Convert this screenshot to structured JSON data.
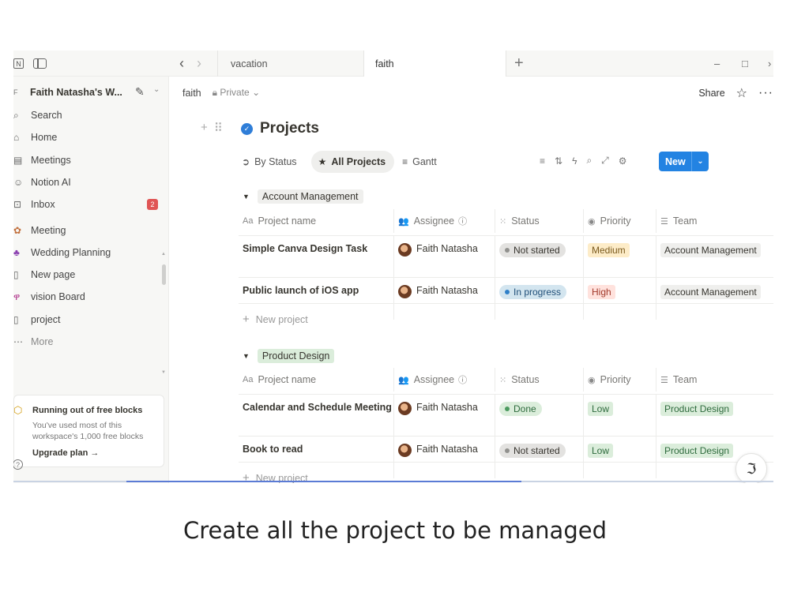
{
  "titlebar": {
    "tabs": [
      {
        "label": "vacation"
      },
      {
        "label": "faith"
      }
    ],
    "new_tab_symbol": "+",
    "window_controls": {
      "minimize": "–",
      "maximize": "□",
      "more": "›"
    }
  },
  "sidebar": {
    "workspace_badge": "F",
    "workspace_name": "Faith Natasha's W...",
    "top_items": [
      {
        "label": "Search",
        "icon": "search-icon"
      },
      {
        "label": "Home",
        "icon": "home-icon"
      },
      {
        "label": "Meetings",
        "icon": "meetings-icon"
      },
      {
        "label": "Notion AI",
        "icon": "notion-ai-icon"
      },
      {
        "label": "Inbox",
        "icon": "inbox-icon",
        "badge": "2"
      }
    ],
    "pages": [
      {
        "label": "Meeting",
        "icon": "meeting-page-icon"
      },
      {
        "label": "Wedding Planning",
        "icon": "wedding-icon"
      },
      {
        "label": "New page",
        "icon": "page-icon"
      },
      {
        "label": "vision Board",
        "icon": "vision-icon"
      },
      {
        "label": "project",
        "icon": "page-icon"
      },
      {
        "label": "More",
        "icon": "more-icon"
      }
    ],
    "upgrade": {
      "title": "Running out of free blocks",
      "body": "You've used most of this workspace's 1,000 free blocks",
      "link": "Upgrade plan →"
    }
  },
  "header": {
    "breadcrumb_page": "faith",
    "privacy": "Private",
    "share_label": "Share"
  },
  "page": {
    "title": "Projects",
    "views": [
      {
        "label": "By Status",
        "icon": "status-view-icon",
        "active": false
      },
      {
        "label": "All Projects",
        "icon": "star-icon",
        "active": true
      },
      {
        "label": "Gantt",
        "icon": "gantt-icon",
        "active": false
      }
    ],
    "new_button": "New",
    "columns": [
      {
        "label": "Project name",
        "icon": "Aa"
      },
      {
        "label": "Assignee",
        "icon": "👥",
        "suffix": "ⓘ"
      },
      {
        "label": "Status",
        "icon": "⁙"
      },
      {
        "label": "Priority",
        "icon": "◉"
      },
      {
        "label": "Team",
        "icon": "☰"
      }
    ],
    "new_project_label": "New project",
    "groups": [
      {
        "name": "Account Management",
        "rows": [
          {
            "name": "Simple Canva Design Task",
            "assignee": "Faith Natasha",
            "status": "Not started",
            "priority": "Medium",
            "team": "Account Management"
          },
          {
            "name": "Public launch of iOS app",
            "assignee": "Faith Natasha",
            "status": "In progress",
            "priority": "High",
            "team": "Account Management"
          }
        ]
      },
      {
        "name": "Product Design",
        "rows": [
          {
            "name": "Calendar and Schedule Meeting",
            "assignee": "Faith Natasha",
            "status": "Done",
            "priority": "Low",
            "team": "Product Design"
          },
          {
            "name": "Book to read",
            "assignee": "Faith Natasha",
            "status": "Not started",
            "priority": "Low",
            "team": "Product Design"
          }
        ]
      }
    ]
  },
  "colors": {
    "accent": "#2383e2",
    "status_not_started": "#e3e2e0",
    "status_in_progress": "#d3e5ef",
    "status_done": "#dbeddb",
    "priority_medium": "#fdecc8",
    "priority_high": "#ffe2dd",
    "priority_low": "#dbeddb"
  },
  "caption": "Create all the project to be managed"
}
